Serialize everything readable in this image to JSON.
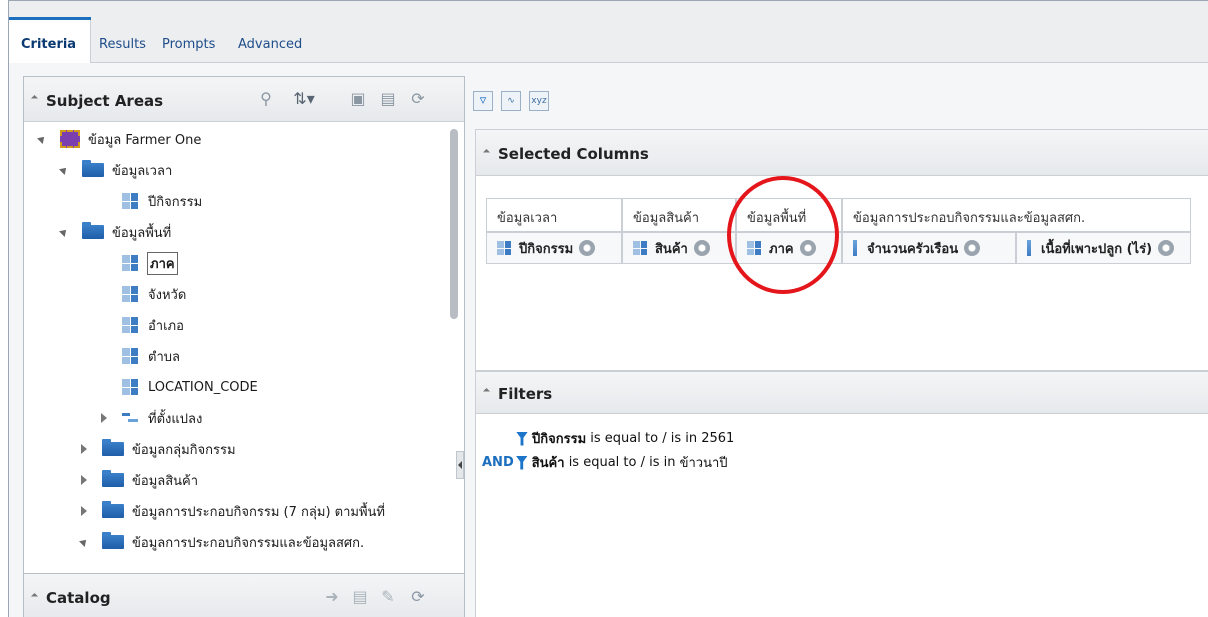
{
  "tabs": [
    {
      "label": "Criteria",
      "active": true
    },
    {
      "label": "Results"
    },
    {
      "label": "Prompts"
    },
    {
      "label": "Advanced"
    }
  ],
  "subject_areas": {
    "title": "Subject Areas",
    "tree": [
      {
        "label": "ข้อมูล Farmer One",
        "type": "subject-area",
        "expanded": true
      },
      {
        "label": "ข้อมูลเวลา",
        "type": "folder",
        "expanded": true
      },
      {
        "label": "ปีกิจกรรม",
        "type": "column"
      },
      {
        "label": "ข้อมูลพื้นที่",
        "type": "folder",
        "expanded": true
      },
      {
        "label": "ภาค",
        "type": "column",
        "selected": true
      },
      {
        "label": "จังหวัด",
        "type": "column"
      },
      {
        "label": "อำเภอ",
        "type": "column"
      },
      {
        "label": "ตำบล",
        "type": "column"
      },
      {
        "label": "LOCATION_CODE",
        "type": "column"
      },
      {
        "label": "ที่ตั้งแปลง",
        "type": "hierarchy"
      },
      {
        "label": "ข้อมูลกลุ่มกิจกรรม",
        "type": "folder"
      },
      {
        "label": "ข้อมูลสินค้า",
        "type": "folder"
      },
      {
        "label": "ข้อมูลการประกอบกิจกรรม (7 กลุ่ม) ตามพื้นที่",
        "type": "folder"
      },
      {
        "label": "ข้อมูลการประกอบกิจกรรมและข้อมูลสศก.",
        "type": "folder",
        "expanded": true
      }
    ]
  },
  "catalog": {
    "title": "Catalog"
  },
  "selected_columns": {
    "title": "Selected Columns",
    "groups": [
      {
        "header": "ข้อมูลเวลา",
        "items": [
          "ปีกิจกรรม"
        ]
      },
      {
        "header": "ข้อมูลสินค้า",
        "items": [
          "สินค้า"
        ]
      },
      {
        "header": "ข้อมูลพื้นที่",
        "items": [
          "ภาค"
        ]
      },
      {
        "header": "ข้อมูลการประกอบกิจกรรมและข้อมูลสศก.",
        "items": [
          "จำนวนครัวเรือน",
          "เนื้อที่เพาะปลูก (ไร่)"
        ]
      }
    ]
  },
  "filters": {
    "title": "Filters",
    "items": [
      {
        "prefix": "",
        "column": "ปีกิจกรรม",
        "op": " is equal to / is in ",
        "value": "2561"
      },
      {
        "prefix": "AND",
        "column": "สินค้า",
        "op": " is equal to / is in ",
        "value": "ข้าวนาปี"
      }
    ]
  },
  "toolbar_icons": [
    "filter-icon",
    "chart-icon",
    "xyz-icon"
  ],
  "colors": {
    "accent": "#1c6fbf",
    "highlight_circle": "#e4161b",
    "folder": "#2f6fb9"
  }
}
